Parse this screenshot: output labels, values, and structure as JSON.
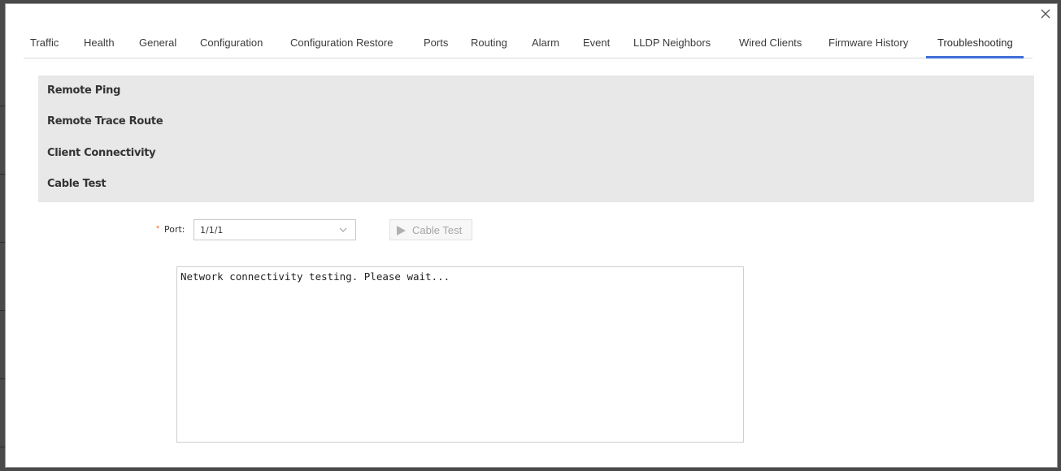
{
  "tabs": [
    {
      "label": "Traffic"
    },
    {
      "label": "Health"
    },
    {
      "label": "General"
    },
    {
      "label": "Configuration"
    },
    {
      "label": "Configuration Restore"
    },
    {
      "label": "Ports"
    },
    {
      "label": "Routing"
    },
    {
      "label": "Alarm"
    },
    {
      "label": "Event"
    },
    {
      "label": "LLDP Neighbors"
    },
    {
      "label": "Wired Clients"
    },
    {
      "label": "Firmware History"
    },
    {
      "label": "Troubleshooting"
    }
  ],
  "active_tab": "Troubleshooting",
  "sections": [
    {
      "label": "Remote Ping"
    },
    {
      "label": "Remote Trace Route"
    },
    {
      "label": "Client Connectivity"
    },
    {
      "label": "Cable Test"
    }
  ],
  "form": {
    "required_marker": "*",
    "port_label": "Port:",
    "port_value": "1/1/1",
    "button_label": "Cable Test",
    "output_text": "Network connectivity testing. Please wait..."
  },
  "colors": {
    "accent": "#3d6fd8",
    "panel_bg": "#e8e8e8",
    "required": "#e8783a"
  },
  "icons": {
    "close": "close-icon",
    "dropdown": "chevron-down-icon",
    "play": "play-icon"
  }
}
